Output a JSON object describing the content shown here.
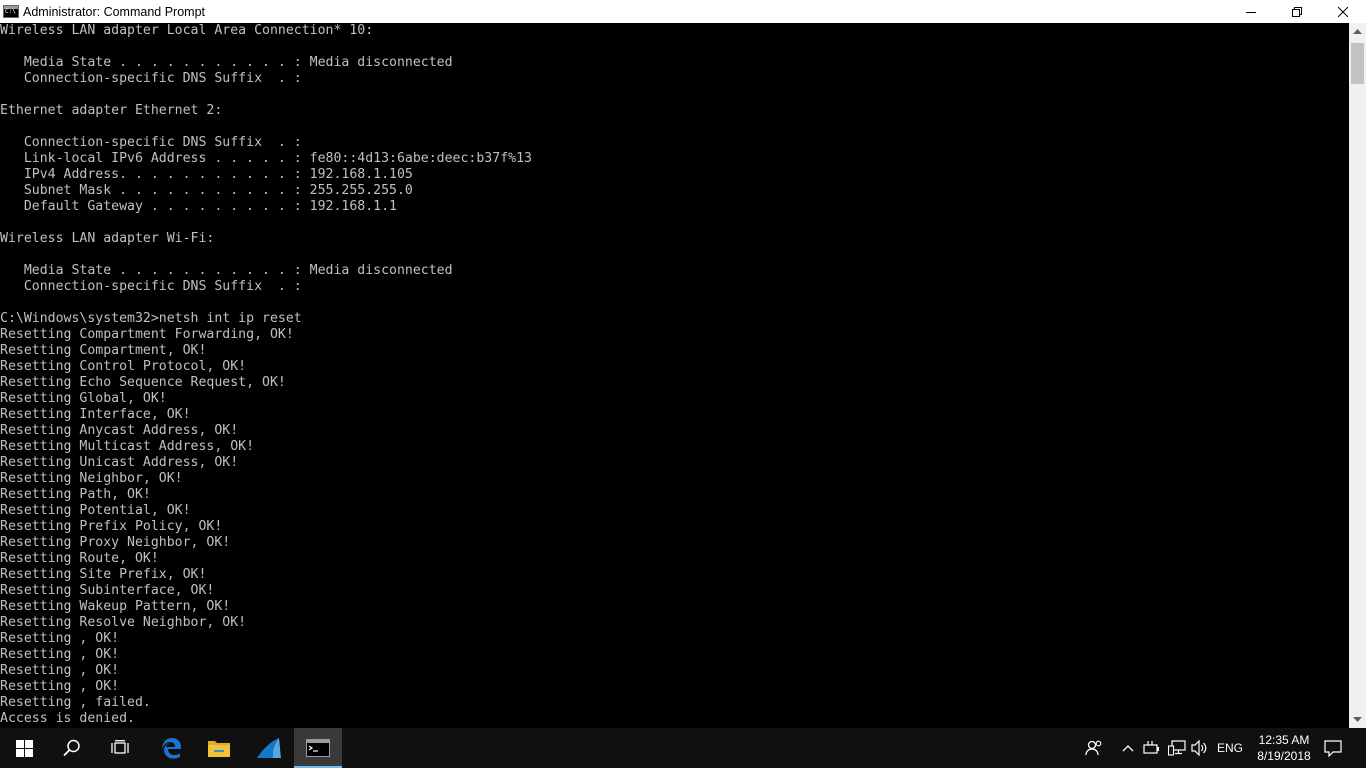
{
  "window": {
    "title": "Administrator: Command Prompt"
  },
  "console": {
    "lines": [
      "Wireless LAN adapter Local Area Connection* 10:",
      "",
      "   Media State . . . . . . . . . . . : Media disconnected",
      "   Connection-specific DNS Suffix  . :",
      "",
      "Ethernet adapter Ethernet 2:",
      "",
      "   Connection-specific DNS Suffix  . :",
      "   Link-local IPv6 Address . . . . . : fe80::4d13:6abe:deec:b37f%13",
      "   IPv4 Address. . . . . . . . . . . : 192.168.1.105",
      "   Subnet Mask . . . . . . . . . . . : 255.255.255.0",
      "   Default Gateway . . . . . . . . . : 192.168.1.1",
      "",
      "Wireless LAN adapter Wi-Fi:",
      "",
      "   Media State . . . . . . . . . . . : Media disconnected",
      "   Connection-specific DNS Suffix  . :",
      "",
      "C:\\Windows\\system32>netsh int ip reset",
      "Resetting Compartment Forwarding, OK!",
      "Resetting Compartment, OK!",
      "Resetting Control Protocol, OK!",
      "Resetting Echo Sequence Request, OK!",
      "Resetting Global, OK!",
      "Resetting Interface, OK!",
      "Resetting Anycast Address, OK!",
      "Resetting Multicast Address, OK!",
      "Resetting Unicast Address, OK!",
      "Resetting Neighbor, OK!",
      "Resetting Path, OK!",
      "Resetting Potential, OK!",
      "Resetting Prefix Policy, OK!",
      "Resetting Proxy Neighbor, OK!",
      "Resetting Route, OK!",
      "Resetting Site Prefix, OK!",
      "Resetting Subinterface, OK!",
      "Resetting Wakeup Pattern, OK!",
      "Resetting Resolve Neighbor, OK!",
      "Resetting , OK!",
      "Resetting , OK!",
      "Resetting , OK!",
      "Resetting , OK!",
      "Resetting , failed.",
      "Access is denied."
    ]
  },
  "taskbar": {
    "icons": [
      "windows-start-icon",
      "search-icon",
      "task-view-icon",
      "edge-icon",
      "file-explorer-icon",
      "wireshark-icon",
      "command-prompt-icon"
    ],
    "tray": {
      "language": "ENG",
      "time": "12:35 AM",
      "date": "8/19/2018"
    }
  },
  "colors": {
    "console_bg": "#000000",
    "console_text": "#c0c0c0",
    "taskbar_bg": "#101010",
    "edge_blue": "#1e73d2",
    "explorer_yellow": "#f2c23a",
    "active_accent": "#76b9ed"
  }
}
